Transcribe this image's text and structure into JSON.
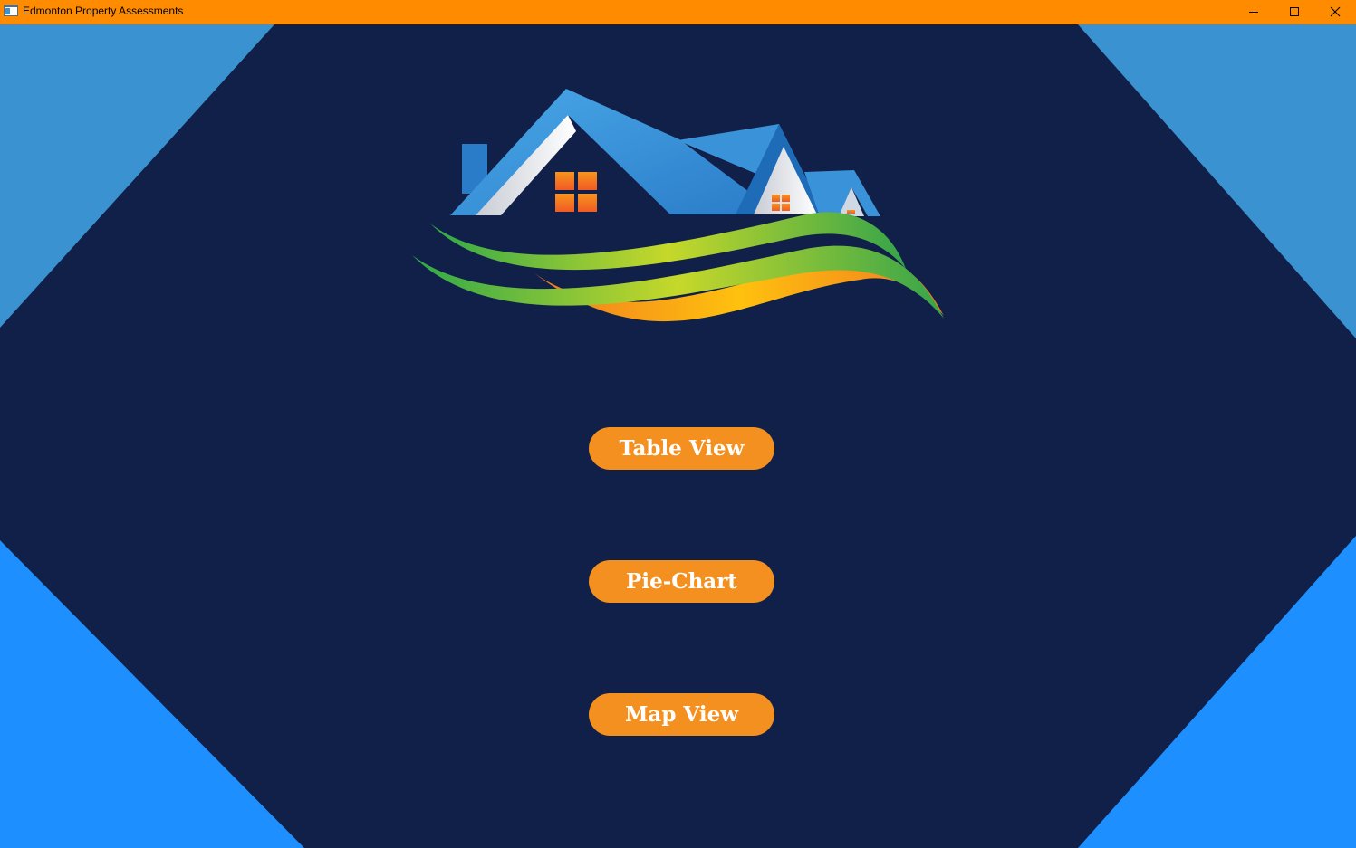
{
  "window": {
    "title": "Edmonton Property Assessments",
    "title_bar_color": "#ff8c00"
  },
  "window_controls": {
    "minimize_icon": "minimize-icon",
    "maximize_icon": "maximize-icon",
    "close_icon": "close-icon"
  },
  "colors": {
    "background": "#102048",
    "corner_top": "#3a93d0",
    "corner_bottom": "#1e8fff",
    "button": "#f39020",
    "button_text": "#ffffff"
  },
  "logo": {
    "icon": "house-logo-icon"
  },
  "buttons": {
    "table_view": "Table View",
    "pie_chart": "Pie-Chart",
    "map_view": "Map View"
  }
}
